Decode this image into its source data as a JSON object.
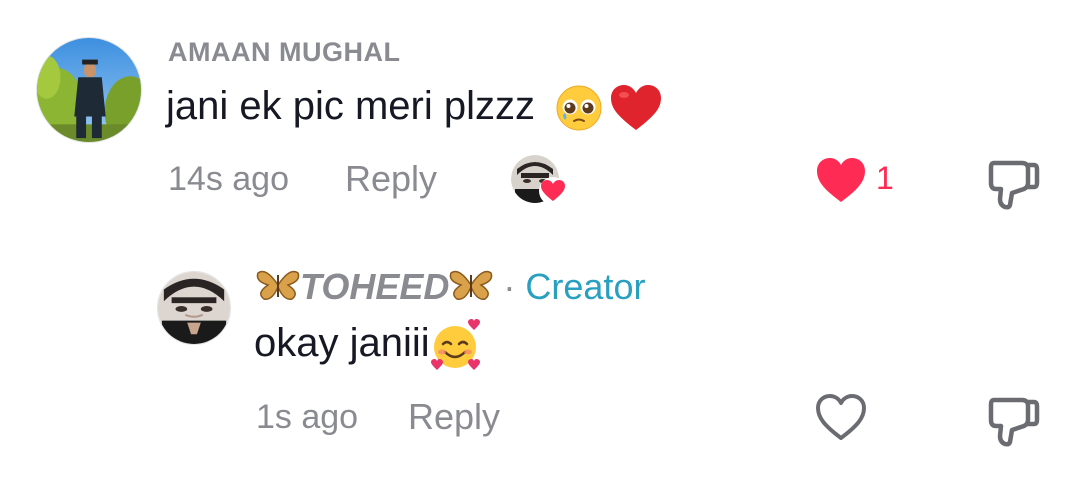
{
  "comments": [
    {
      "username": "AMAAN MUGHAL",
      "text": "jani ek pic meri plzzz",
      "emojis": [
        "pleading-face-emoji",
        "red-heart-emoji"
      ],
      "time": "14s ago",
      "reply_label": "Reply",
      "liked_by_creator": true,
      "likes": "1",
      "liked": true
    },
    {
      "username_decor": "🦋",
      "username": "TOHEED",
      "dot": "·",
      "badge": "Creator",
      "text": "okay janiii",
      "emojis": [
        "smiling-face-with-hearts-emoji"
      ],
      "time": "1s ago",
      "reply_label": "Reply",
      "liked": false
    }
  ],
  "colors": {
    "like_red": "#fe2c55",
    "muted_gray": "#8a8b91",
    "creator_blue": "#2aa0c0",
    "text": "#161823"
  }
}
